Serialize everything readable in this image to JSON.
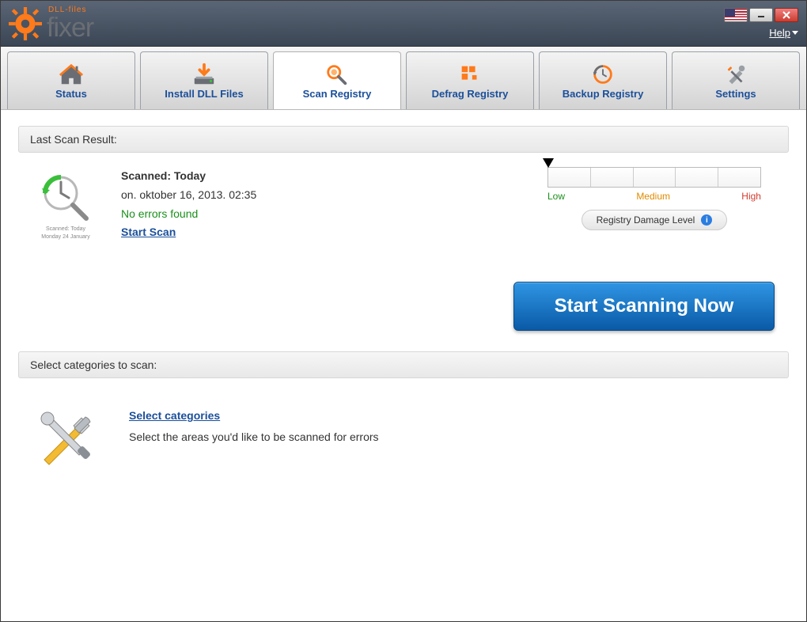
{
  "titlebar": {
    "brand_sub": "DLL-files",
    "brand_main": "fixer",
    "help_label": "Help"
  },
  "tabs": [
    {
      "id": "status",
      "label": "Status"
    },
    {
      "id": "install",
      "label": "Install DLL Files"
    },
    {
      "id": "scanreg",
      "label": "Scan Registry"
    },
    {
      "id": "defrag",
      "label": "Defrag Registry"
    },
    {
      "id": "backup",
      "label": "Backup Registry"
    },
    {
      "id": "settings",
      "label": "Settings"
    }
  ],
  "active_tab": "scanreg",
  "last_scan": {
    "header": "Last Scan Result:",
    "title": "Scanned: Today",
    "subtitle": "on. oktober 16, 2013. 02:35",
    "status": "No errors found",
    "start_link": "Start Scan",
    "icon_caption_1": "Scanned: Today",
    "icon_caption_2": "Monday 24 January"
  },
  "damage": {
    "low": "Low",
    "medium": "Medium",
    "high": "High",
    "pill": "Registry Damage Level"
  },
  "start_button": "Start Scanning Now",
  "categories": {
    "header": "Select categories to scan:",
    "link": "Select categories",
    "desc": "Select the areas you'd like to be scanned for errors"
  }
}
